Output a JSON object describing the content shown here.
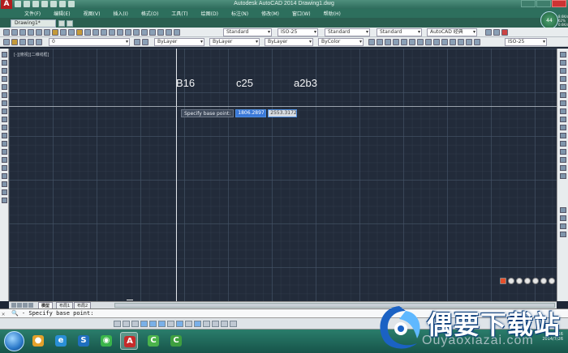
{
  "window": {
    "title": "Autodesk AutoCAD 2014    Drawing1.dwg",
    "app_button": "A"
  },
  "menu": {
    "items": [
      "文件(F)",
      "编辑(E)",
      "视图(V)",
      "插入(I)",
      "格式(O)",
      "工具(T)",
      "绘图(D)",
      "标注(N)",
      "修改(M)",
      "窗口(W)",
      "帮助(H)"
    ]
  },
  "tabs": {
    "document_tab": "Drawing1*"
  },
  "toolbar": {
    "text_style": "Standard",
    "dim_style": "ISO-25",
    "table_style": "Standard",
    "mleader_style": "Standard",
    "workspace": "AutoCAD 经典",
    "layer_current": "0",
    "color_control": "ByLayer",
    "linetype_control": "ByLayer",
    "lineweight_control": "ByLayer",
    "plot_style": "ByColor",
    "annotation_scale": "ISO-25"
  },
  "badge": {
    "text": "44",
    "side_text": "8.6K/s 62% 0.6K/s"
  },
  "canvas": {
    "viewport_label": "[-][俯视][二维线框]",
    "text_b16": "B16",
    "text_c25": "c25",
    "text_a2b3": "a2b3",
    "prompt_label": "Specify base point:",
    "field_x": "1806.2897",
    "field_y": "2553.3172"
  },
  "layout_tabs": {
    "model": "模型",
    "layout1": "布局1",
    "layout2": "布局2"
  },
  "command_line": {
    "text": "🔍 - Specify base point:"
  },
  "watermark": {
    "brand": "偶要下载站",
    "url": "Ouyaoxiazai.com"
  },
  "tray": {
    "time": "11:16",
    "date": "2014/7/26"
  }
}
